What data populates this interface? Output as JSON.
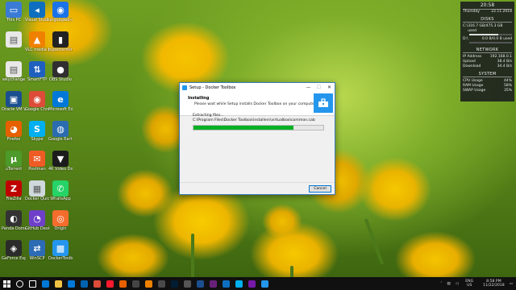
{
  "desktop": {
    "icons": [
      {
        "label": "This PC",
        "color": "#3a7bd5",
        "glyph": "▭",
        "icon": "computer-icon"
      },
      {
        "label": "Visual Studio Code",
        "color": "#0e6fc0",
        "glyph": "◂",
        "icon": "vscode-icon"
      },
      {
        "label": "ungoogled-chromium",
        "color": "#1a73e8",
        "glyph": "◉",
        "icon": "chromium-icon"
      },
      {
        "label": "",
        "color": "#e8e8e8",
        "glyph": "▤",
        "icon": "document-icon"
      },
      {
        "label": "VLC media player",
        "color": "#f08000",
        "glyph": "▲",
        "icon": "vlc-icon"
      },
      {
        "label": "hyperterminal",
        "color": "#222222",
        "glyph": "▮",
        "icon": "terminal-icon"
      },
      {
        "label": "wkychange",
        "color": "#e8e8e8",
        "glyph": "▤",
        "icon": "document-icon"
      },
      {
        "label": "SmartFTP",
        "color": "#1f5fbf",
        "glyph": "⇅",
        "icon": "ftp-icon"
      },
      {
        "label": "OBS Studio",
        "color": "#302e31",
        "glyph": "●",
        "icon": "obs-icon"
      },
      {
        "label": "Oracle VM VirtualBox",
        "color": "#1b4f8f",
        "glyph": "▣",
        "icon": "virtualbox-icon"
      },
      {
        "label": "Google Chrome",
        "color": "#dd4b39",
        "glyph": "◉",
        "icon": "chrome-icon"
      },
      {
        "label": "Microsoft Edge",
        "color": "#0078d7",
        "glyph": "e",
        "icon": "edge-icon"
      },
      {
        "label": "Firefox",
        "color": "#e66000",
        "glyph": "◕",
        "icon": "firefox-icon"
      },
      {
        "label": "Skype",
        "color": "#00aff0",
        "glyph": "S",
        "icon": "skype-icon"
      },
      {
        "label": "Google Earth",
        "color": "#2b6cb0",
        "glyph": "◍",
        "icon": "earth-icon"
      },
      {
        "label": "uTorrent",
        "color": "#4c9a2a",
        "glyph": "µ",
        "icon": "utorrent-icon"
      },
      {
        "label": "Postman",
        "color": "#ef5b25",
        "glyph": "✉",
        "icon": "postman-icon"
      },
      {
        "label": "4K Video Downloader",
        "color": "#1c1c1c",
        "glyph": "▼",
        "icon": "downloader-icon"
      },
      {
        "label": "FileZilla",
        "color": "#bf0000",
        "glyph": "Z",
        "icon": "filezilla-icon"
      },
      {
        "label": "Docker Quickstart",
        "color": "#cfd8dc",
        "glyph": "▦",
        "icon": "docker-quickstart-icon"
      },
      {
        "label": "WhatsApp",
        "color": "#25d366",
        "glyph": "✆",
        "icon": "whatsapp-icon"
      },
      {
        "label": "Panda Dome",
        "color": "#333333",
        "glyph": "◐",
        "icon": "panda-icon"
      },
      {
        "label": "GitHub Desktop",
        "color": "#6e40c9",
        "glyph": "◔",
        "icon": "github-icon"
      },
      {
        "label": "Origin",
        "color": "#f56c2d",
        "glyph": "◎",
        "icon": "origin-icon"
      },
      {
        "label": "GeForce Experience",
        "color": "#2b2b2b",
        "glyph": "◈",
        "icon": "geforce-icon"
      },
      {
        "label": "WinSCP",
        "color": "#2d6bb5",
        "glyph": "⇄",
        "icon": "winscp-icon"
      },
      {
        "label": "DockerToolbox",
        "color": "#2496ed",
        "glyph": "▩",
        "icon": "docker-toolbox-icon"
      }
    ]
  },
  "widget": {
    "time": "20:58",
    "day": "Thursday",
    "date": "22.11.2018",
    "disks_header": "DISKS",
    "disks": [
      {
        "label": "C:\\",
        "value": "316.7 GB/475.3 GB used",
        "fill": 0.67
      },
      {
        "label": "D:\\",
        "value": "0.0 B/0.0 B used",
        "fill": 0.0
      }
    ],
    "network_header": "NETWORK",
    "network": [
      {
        "label": "IP Address",
        "value": "192.168.0.1"
      },
      {
        "label": "Upload",
        "value": "38.4 B/s"
      },
      {
        "label": "Download",
        "value": "34.4 B/s"
      }
    ],
    "system_header": "SYSTEM",
    "system": [
      {
        "label": "CPU Usage",
        "value": "44%"
      },
      {
        "label": "RAM Usage",
        "value": "58%"
      },
      {
        "label": "SWAP Usage",
        "value": "35%"
      }
    ]
  },
  "dialog": {
    "title": "Setup - Docker Toolbox",
    "heading": "Installing",
    "subheading": "Please wait while Setup installs Docker Toolbox on your computer.",
    "status": "Extracting files...",
    "file_path": "C:\\Program Files\\Docker Toolbox\\installers\\virtualbox\\common.cab",
    "progress": 0.77,
    "cancel_label": "Cancel",
    "minimize": "—",
    "maximize": "☐",
    "close": "✕"
  },
  "taskbar": {
    "apps": [
      {
        "name": "search-icon",
        "color": "#000000",
        "glyph": "○"
      },
      {
        "name": "task-view-icon",
        "color": "#000000",
        "glyph": "▭"
      },
      {
        "name": "edge-taskbar-icon",
        "color": "#0078d7",
        "glyph": "e"
      },
      {
        "name": "file-explorer-icon",
        "color": "#f4c242",
        "glyph": ""
      },
      {
        "name": "store-icon",
        "color": "#0078d7",
        "glyph": ""
      },
      {
        "name": "mail-icon",
        "color": "#0063b1",
        "glyph": ""
      },
      {
        "name": "chrome-taskbar-icon",
        "color": "#dd4b39",
        "glyph": ""
      },
      {
        "name": "opera-icon",
        "color": "#ff1b2d",
        "glyph": ""
      },
      {
        "name": "firefox-taskbar-icon",
        "color": "#e66000",
        "glyph": ""
      },
      {
        "name": "media-icon",
        "color": "#444444",
        "glyph": ""
      },
      {
        "name": "vlc-taskbar-icon",
        "color": "#f08000",
        "glyph": ""
      },
      {
        "name": "app-icon",
        "color": "#4a4a4a",
        "glyph": ""
      },
      {
        "name": "photoshop-icon",
        "color": "#001d34",
        "glyph": ""
      },
      {
        "name": "settings-icon",
        "color": "#555555",
        "glyph": ""
      },
      {
        "name": "virtualbox-taskbar-icon",
        "color": "#1b4f8f",
        "glyph": ""
      },
      {
        "name": "visual-studio-icon",
        "color": "#68217a",
        "glyph": ""
      },
      {
        "name": "vscode-taskbar-icon",
        "color": "#0e6fc0",
        "glyph": ""
      },
      {
        "name": "skype-taskbar-icon",
        "color": "#00aff0",
        "glyph": ""
      },
      {
        "name": "onenote-icon",
        "color": "#7719aa",
        "glyph": ""
      },
      {
        "name": "docker-setup-taskbar-icon",
        "color": "#2496ed",
        "glyph": ""
      }
    ],
    "lang": "ENG",
    "region": "US",
    "time": "8:58 PM",
    "date": "11/22/2018"
  }
}
